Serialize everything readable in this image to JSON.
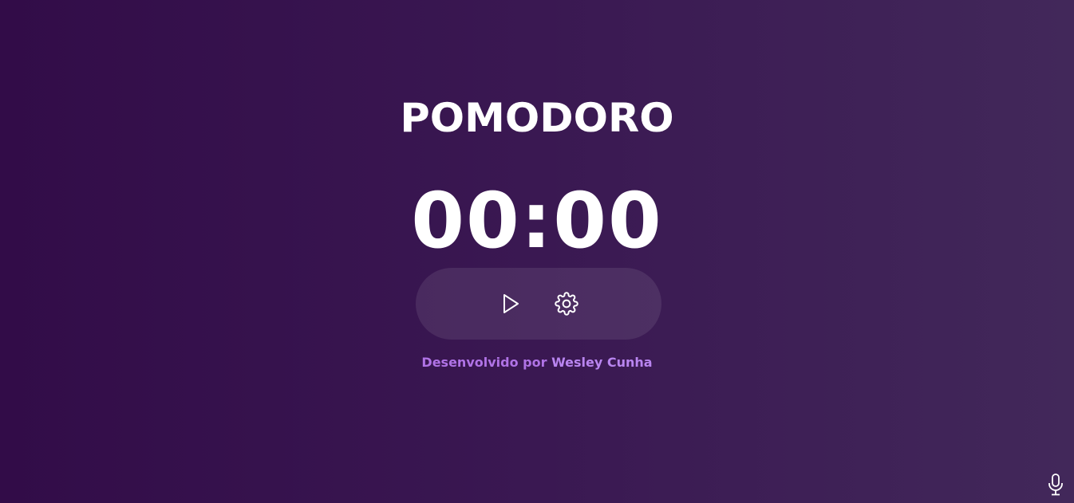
{
  "app": {
    "title": "POMODORO",
    "timer": "00:00"
  },
  "controls": {
    "play_icon": "play-icon",
    "settings_icon": "gear-icon"
  },
  "footer": {
    "credit_prefix": "Desenvolvido por",
    "author": "Wesley Cunha"
  },
  "corner": {
    "icon": "microphone-icon"
  },
  "colors": {
    "background_start": "#320c48",
    "background_end": "#42285a",
    "accent": "#b073e6",
    "text": "#ffffff"
  }
}
